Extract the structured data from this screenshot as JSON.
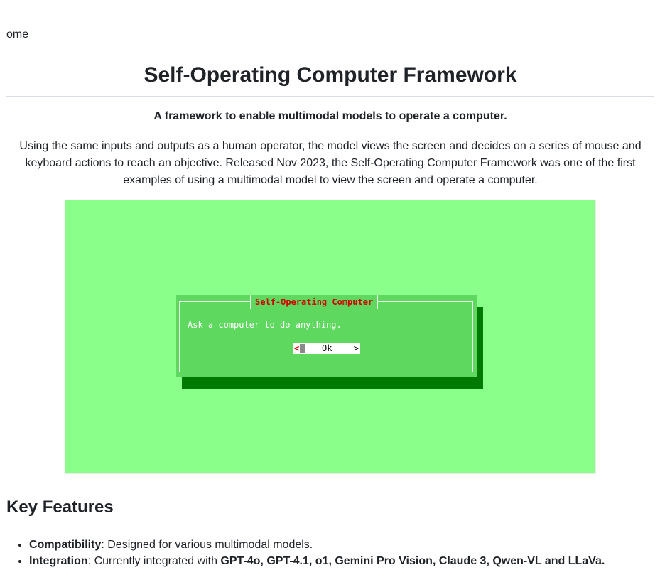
{
  "breadcrumb": "ome",
  "page_title": "Self-Operating Computer Framework",
  "subtitle": "A framework to enable multimodal models to operate a computer.",
  "description": "Using the same inputs and outputs as a human operator, the model views the screen and decides on a series of mouse and keyboard actions to reach an objective. Released Nov 2023, the Self-Operating Computer Framework was one of the first examples of using a multimodal model to view the screen and operate a computer.",
  "demo": {
    "background": "#8aff8a",
    "dialog_title": "Self-Operating Computer",
    "dialog_message": "Ask a computer to do anything.",
    "ok_left": "<",
    "ok_label": "Ok",
    "ok_right": ">"
  },
  "key_features": {
    "heading": "Key Features",
    "items": [
      {
        "name": "Compatibility",
        "text": ": Designed for various multimodal models."
      },
      {
        "name": "Integration",
        "text": ": Currently integrated with ",
        "models": "GPT-4o, GPT-4.1, o1, Gemini Pro Vision, Claude 3, Qwen-VL and LLaVa."
      }
    ]
  }
}
